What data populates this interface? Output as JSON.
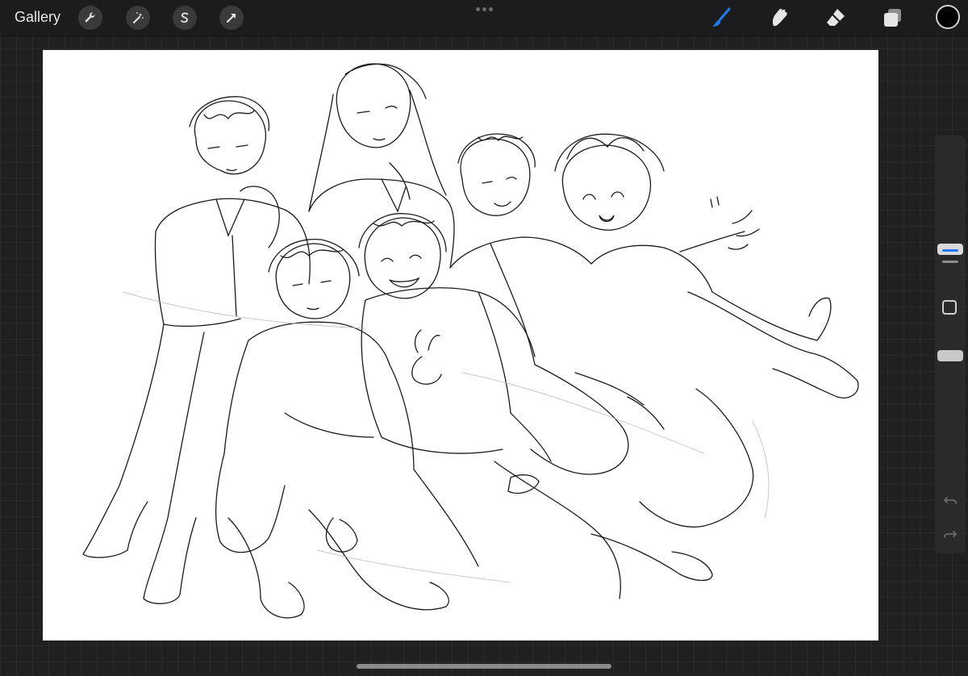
{
  "topbar": {
    "gallery_label": "Gallery",
    "left_tools": [
      {
        "name": "actions",
        "icon": "wrench-icon"
      },
      {
        "name": "adjustments",
        "icon": "magic-wand-icon"
      },
      {
        "name": "selection",
        "icon": "selection-s-icon"
      },
      {
        "name": "transform",
        "icon": "arrow-cursor-icon"
      }
    ],
    "right_tools": [
      {
        "name": "brush",
        "icon": "brush-icon",
        "active": true
      },
      {
        "name": "smudge",
        "icon": "smudge-icon",
        "active": false
      },
      {
        "name": "eraser",
        "icon": "eraser-icon",
        "active": false
      },
      {
        "name": "layers",
        "icon": "layers-icon",
        "active": false
      }
    ],
    "current_color": "#000000",
    "active_tool_color": "#1e7cf2"
  },
  "sidebar": {
    "brush_size_fraction": 0.27,
    "opacity_fraction": 0.52,
    "icons": [
      "modify-square-icon",
      "undo-icon",
      "redo-icon"
    ]
  },
  "canvas": {
    "background": "#ffffff",
    "content": "pencil-sketch-drawing"
  }
}
